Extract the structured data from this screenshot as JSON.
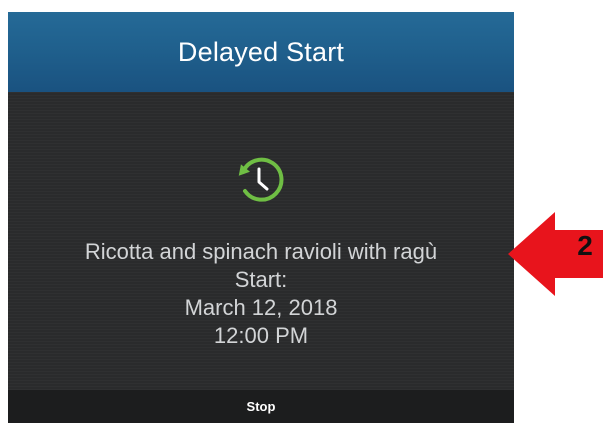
{
  "header": {
    "title": "Delayed Start"
  },
  "main": {
    "icon": "delayed-start-clock-icon",
    "recipe_name": "Ricotta and spinach ravioli with ragù",
    "start_label": "Start:",
    "start_date": "March 12, 2018",
    "start_time": "12:00 PM"
  },
  "footer": {
    "stop_label": "Stop"
  },
  "callout": {
    "number": "2",
    "color": "#e8141c"
  },
  "colors": {
    "header_blue": "#1f5f8c",
    "background": "#2a2b2c",
    "icon_green": "#6fbe44",
    "text": "#d2d4d6"
  }
}
